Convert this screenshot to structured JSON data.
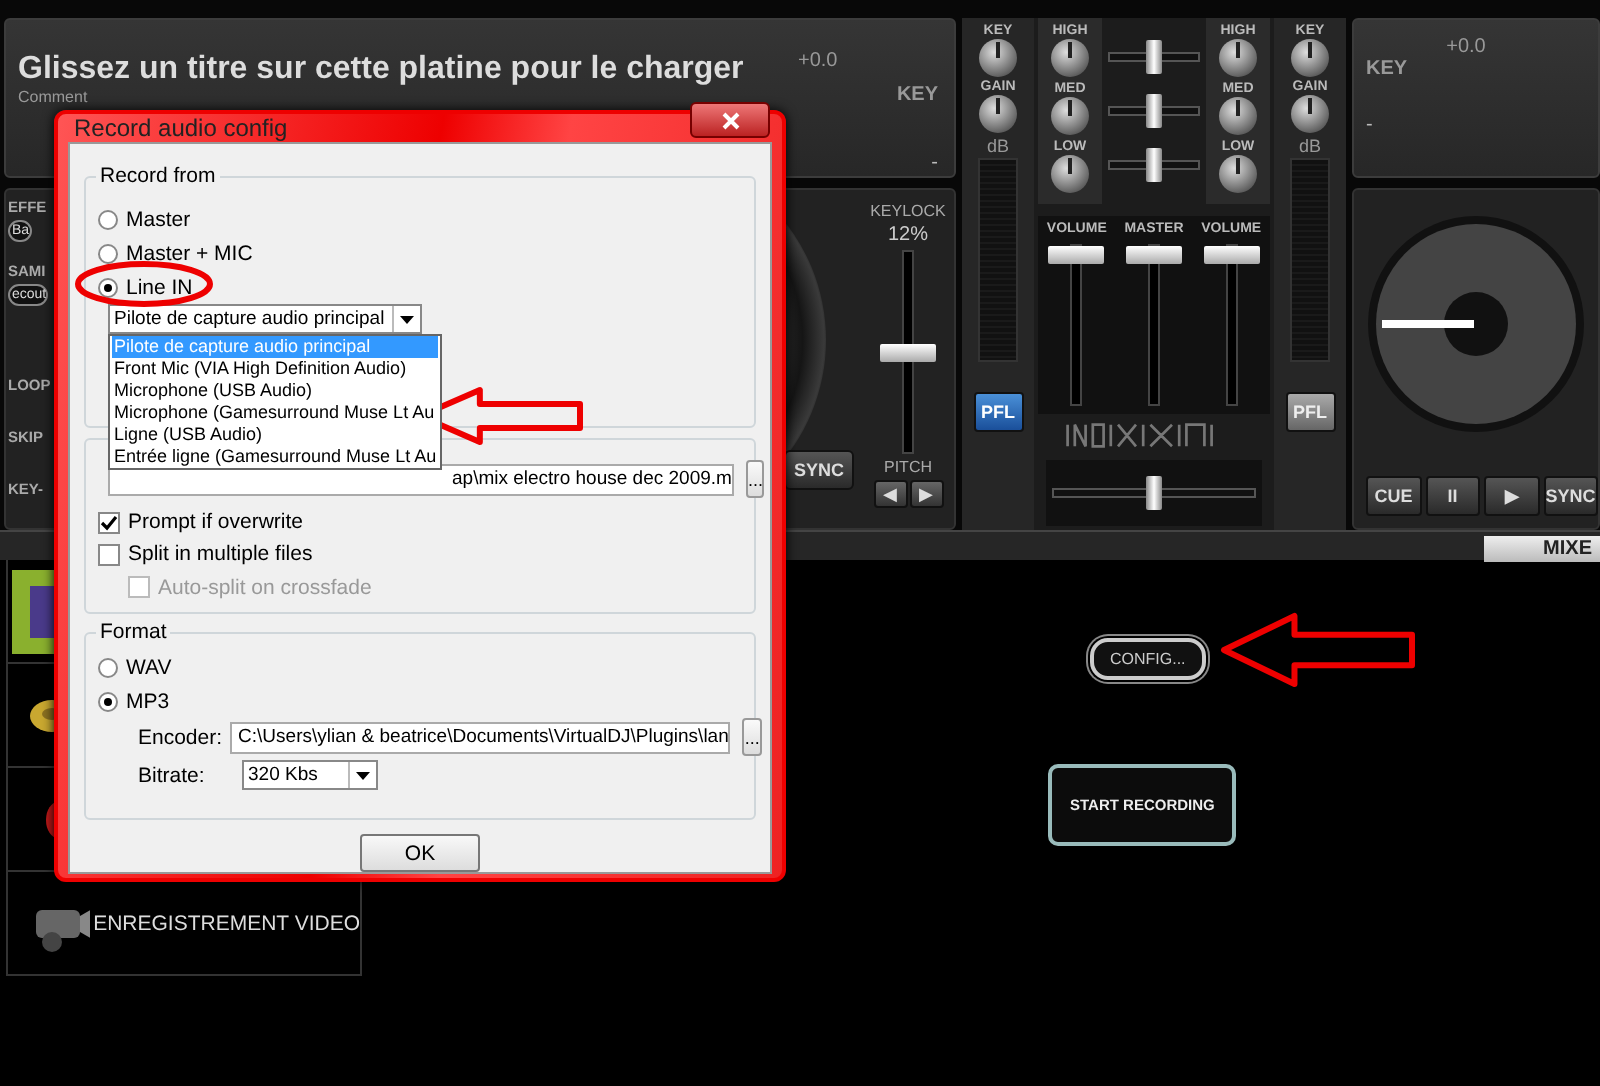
{
  "deck_left": {
    "title": "Glissez un titre sur cette platine pour le charger",
    "comment": "Comment",
    "pitch_value": "+0.0",
    "key_label": "KEY",
    "key_value": "-",
    "side_labels": [
      "EFFE",
      "SAMI"
    ],
    "effect_value": "Ba",
    "sampler_value": "ecout",
    "loop_labels": [
      "LOOP",
      "SKIP",
      "KEY-"
    ],
    "keylock_label": "KEYLOCK",
    "pitch_percent": "12%",
    "pitch_slider": {
      "level": 0.5
    },
    "sync_label": "SYNC",
    "pitch_label": "PITCH",
    "pitch_buttons": [
      "◀",
      "▶"
    ]
  },
  "mixer": {
    "left_knobs": [
      "KEY",
      "GAIN"
    ],
    "left_eq": [
      "HIGH",
      "MED",
      "LOW"
    ],
    "right_eq": [
      "HIGH",
      "MED",
      "LOW"
    ],
    "right_knobs": [
      "KEY",
      "GAIN"
    ],
    "meter_labels": [
      "dB",
      "dB"
    ],
    "center_sliders": [
      {
        "level": 0.5
      },
      {
        "level": 0.5
      },
      {
        "level": 0.5
      }
    ],
    "faders": [
      {
        "label": "VOLUME",
        "level": 1
      },
      {
        "label": "MASTER",
        "level": 1
      },
      {
        "label": "VOLUME",
        "level": 1
      }
    ],
    "pfl": [
      {
        "label": "PFL",
        "on": true
      },
      {
        "label": "PFL",
        "on": false
      }
    ],
    "crossfader": {
      "level": 0.5
    }
  },
  "deck_right": {
    "pitch_value": "+0.0",
    "key_label": "KEY",
    "key_value": "-",
    "transport": [
      "CUE",
      "II",
      "▶",
      "SYNC"
    ]
  },
  "bottom_tab": "MIXE",
  "sidebar": {
    "items": [
      {
        "kind": "tile"
      },
      {
        "kind": "tile"
      },
      {
        "kind": "tile"
      },
      {
        "kind": "labeled",
        "label": "ENREGISTREMENT VIDEO"
      }
    ]
  },
  "config_button": "CONFIG...",
  "start_button": "START RECORDING",
  "dialog": {
    "title": "Record audio config",
    "record_from": {
      "legend": "Record from",
      "options": [
        {
          "label": "Master",
          "selected": false
        },
        {
          "label": "Master + MIC",
          "selected": false
        },
        {
          "label": "Line IN",
          "selected": true
        }
      ],
      "device": {
        "value": "Pilote de capture audio principal",
        "options": [
          {
            "label": "Pilote de capture audio principal",
            "selected": true
          },
          {
            "label": "Front Mic (VIA High Definition Audio)",
            "selected": false
          },
          {
            "label": "Microphone (USB Audio)",
            "selected": false
          },
          {
            "label": "Microphone (Gamesurround Muse Lt Au",
            "selected": false
          },
          {
            "label": "Ligne (USB Audio)",
            "selected": false
          },
          {
            "label": "Entrée ligne (Gamesurround Muse Lt Au",
            "selected": false
          }
        ]
      }
    },
    "output": {
      "file": "ap\\mix electro house dec 2009.m",
      "browse": "...",
      "checkboxes": [
        {
          "label": "Prompt if overwrite",
          "checked": true,
          "disabled": false
        },
        {
          "label": "Split in multiple files",
          "checked": false,
          "disabled": false,
          "children": [
            {
              "label": "Auto-split on crossfade",
              "checked": false,
              "disabled": true
            }
          ]
        }
      ]
    },
    "format": {
      "legend": "Format",
      "options": [
        {
          "label": "WAV",
          "selected": false
        },
        {
          "label": "MP3",
          "selected": true
        }
      ],
      "encoder_label": "Encoder:",
      "encoder": "C:\\Users\\ylian & beatrice\\Documents\\VirtualDJ\\Plugins\\lan",
      "browse": "...",
      "bitrate_label": "Bitrate:",
      "bitrate": "320 Kbs"
    },
    "ok": "OK"
  },
  "annotations": [
    {
      "kind": "ellipse"
    },
    {
      "kind": "arrow"
    },
    {
      "kind": "arrow"
    }
  ]
}
